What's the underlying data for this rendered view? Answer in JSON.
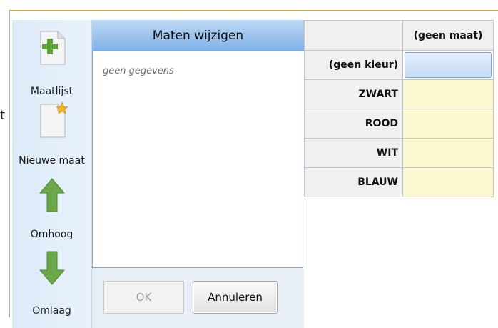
{
  "stray_char": "t",
  "toolbar": {
    "items": [
      {
        "label": "Maatlijst",
        "icon": "document-add-icon"
      },
      {
        "label": "Nieuwe maat",
        "icon": "new-document-star-icon"
      },
      {
        "label": "Omhoog",
        "icon": "arrow-up-icon"
      },
      {
        "label": "Omlaag",
        "icon": "arrow-down-icon"
      }
    ]
  },
  "dialog": {
    "title": "Maten wijzigen",
    "empty_text": "geen gegevens",
    "ok_label": "OK",
    "cancel_label": "Annuleren"
  },
  "grid": {
    "column_header": "(geen maat)",
    "rows": [
      "(geen kleur)",
      "ZWART",
      "ROOD",
      "WIT",
      "BLAUW"
    ]
  },
  "colors": {
    "frame": "#e3a54a",
    "header_blue": "#7fb2e8",
    "cell_yellow": "#fbf7cf",
    "icon_green": "#5ea33a"
  }
}
